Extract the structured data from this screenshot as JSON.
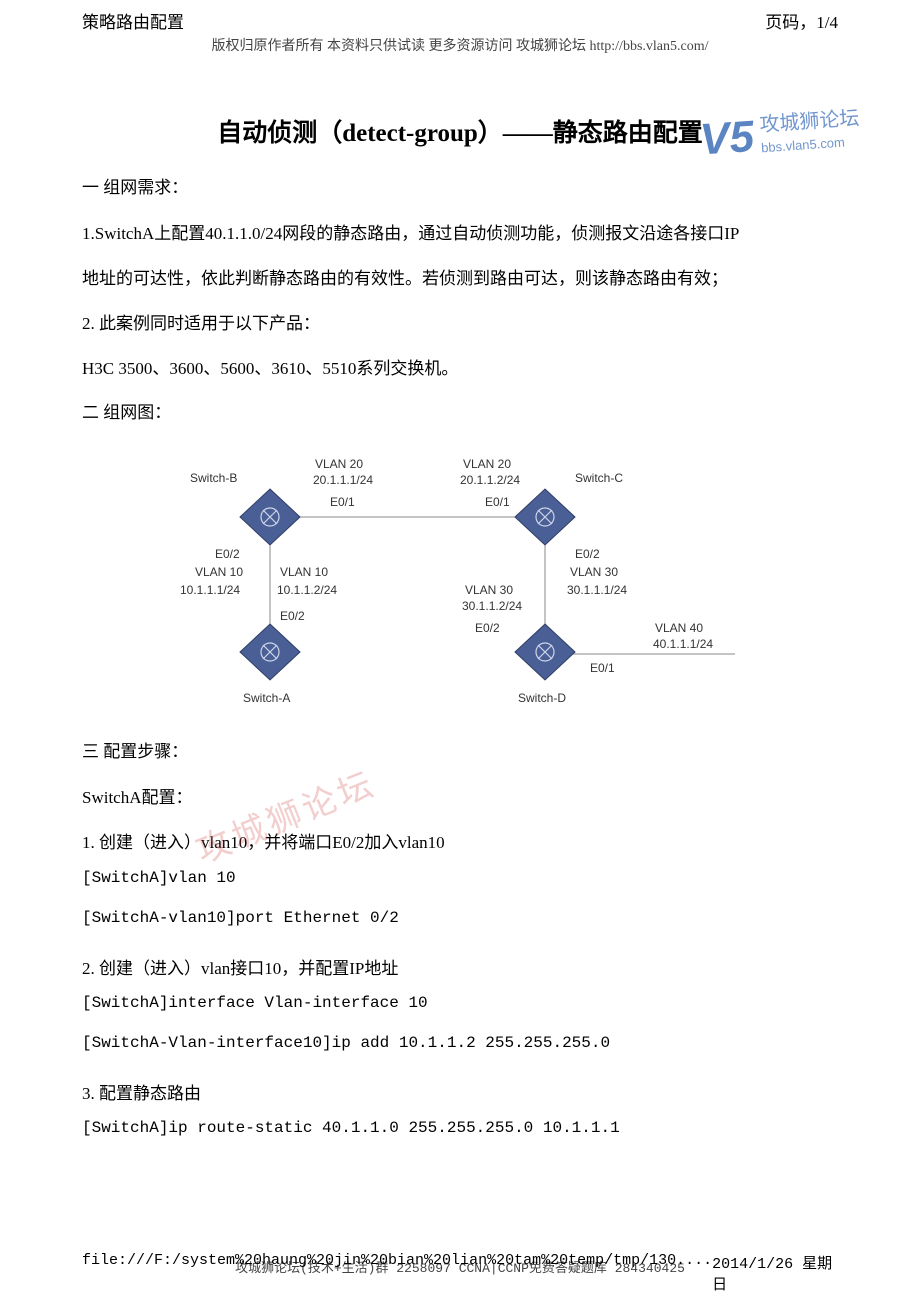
{
  "header": {
    "left": "策略路由配置",
    "right": "页码，1/4",
    "copyright": "版权归原作者所有 本资料只供试读 更多资源访问 攻城狮论坛 http://bbs.vlan5.com/"
  },
  "watermark_top": {
    "logo": "V5",
    "line1": "攻城狮论坛",
    "line2": "bbs.vlan5.com"
  },
  "watermark_mid": "攻城狮论坛",
  "title": "自动侦测（detect-group）——静态路由配置",
  "sections": {
    "s1": "一  组网需求：",
    "p1": "1.SwitchA上配置40.1.1.0/24网段的静态路由，通过自动侦测功能，侦测报文沿途各接口IP",
    "p2": "地址的可达性，依此判断静态路由的有效性。若侦测到路由可达，则该静态路由有效；",
    "p3": "2. 此案例同时适用于以下产品：",
    "p4": "H3C 3500、3600、5600、3610、5510系列交换机。",
    "s2": "二  组网图：",
    "s3": "三  配置步骤：",
    "p5": "SwitchA配置：",
    "p6": "1. 创建（进入）vlan10，并将端口E0/2加入vlan10",
    "c1": "[SwitchA]vlan 10",
    "c2": "[SwitchA-vlan10]port Ethernet 0/2",
    "p7": "2. 创建（进入）vlan接口10，并配置IP地址",
    "c3": "[SwitchA]interface Vlan-interface 10",
    "c4": "[SwitchA-Vlan-interface10]ip add 10.1.1.2 255.255.255.0",
    "p8": "3. 配置静态路由",
    "c5": "[SwitchA]ip route-static 40.1.1.0 255.255.255.0 10.1.1.1"
  },
  "diagram": {
    "switch_b": "Switch-B",
    "switch_c": "Switch-C",
    "switch_a": "Switch-A",
    "switch_d": "Switch-D",
    "vlan20a": "VLAN 20",
    "vlan20a_ip": "20.1.1.1/24",
    "vlan20b": "VLAN 20",
    "vlan20b_ip": "20.1.1.2/24",
    "e01": "E0/1",
    "e02": "E0/2",
    "vlan10a": "VLAN 10",
    "vlan10a_ip": "10.1.1.1/24",
    "vlan10b": "VLAN 10",
    "vlan10b_ip": "10.1.1.2/24",
    "vlan30a": "VLAN 30",
    "vlan30a_ip": "30.1.1.1/24",
    "vlan30b": "VLAN 30",
    "vlan30b_ip": "30.1.1.2/24",
    "vlan40": "VLAN 40",
    "vlan40_ip": "40.1.1.1/24"
  },
  "footer": {
    "qq": "攻城狮论坛(技术+生活)群 2258097 CCNA|CCNP免费答疑题库 284340425",
    "path": "file:///F:/system%20haung%20jin%20bian%20lian%20tam%20temp/tmp/130....",
    "date": "2014/1/26 星期日"
  }
}
